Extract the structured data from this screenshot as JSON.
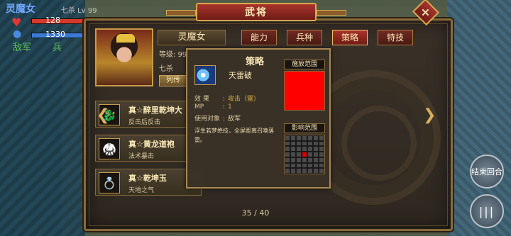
{
  "hud": {
    "unit_name": "灵魔女",
    "unit_info": "七杀 Lv 99",
    "hp": "128",
    "mp": "1330",
    "faction": "敌军",
    "troop": "兵"
  },
  "panel": {
    "title": "武将",
    "close_label": "×"
  },
  "hero": {
    "name": "灵魔女",
    "level": "等级: 99",
    "skill": "七杀",
    "bio_button": "列传"
  },
  "tabs": [
    {
      "label": "能力",
      "active": false
    },
    {
      "label": "兵种",
      "active": false
    },
    {
      "label": "策略",
      "active": true
    },
    {
      "label": "特技",
      "active": false
    }
  ],
  "items": [
    {
      "name": "真☆醉里乾坤大",
      "desc": "反击后反击",
      "icon": "dragon-orb-icon"
    },
    {
      "name": "真☆黄龙道袍",
      "desc": "法术暴击",
      "icon": "robe-icon"
    },
    {
      "name": "真☆乾坤玉",
      "desc": "天地之气",
      "icon": "jade-icon"
    }
  ],
  "pagination": "35 / 40",
  "tooltip": {
    "title": "策略",
    "skill_name": "天雷破",
    "effect_key": "效 果",
    "effect_value": "攻击（雷）",
    "mp_key": "MP",
    "mp_value": "1",
    "target_key": "使用对象",
    "target_value": "敌军",
    "description": "浮生若梦绝技，全屏距离召唤落雷。",
    "cast_range_label": "施放范围",
    "impact_range_label": "影响范围"
  },
  "side_buttons": {
    "end_turn": "结束回合",
    "menu": "|||"
  },
  "colors": {
    "accent_red": "#a8342a",
    "gold_border": "#d8a850",
    "cast_fill": "#ff0000"
  }
}
